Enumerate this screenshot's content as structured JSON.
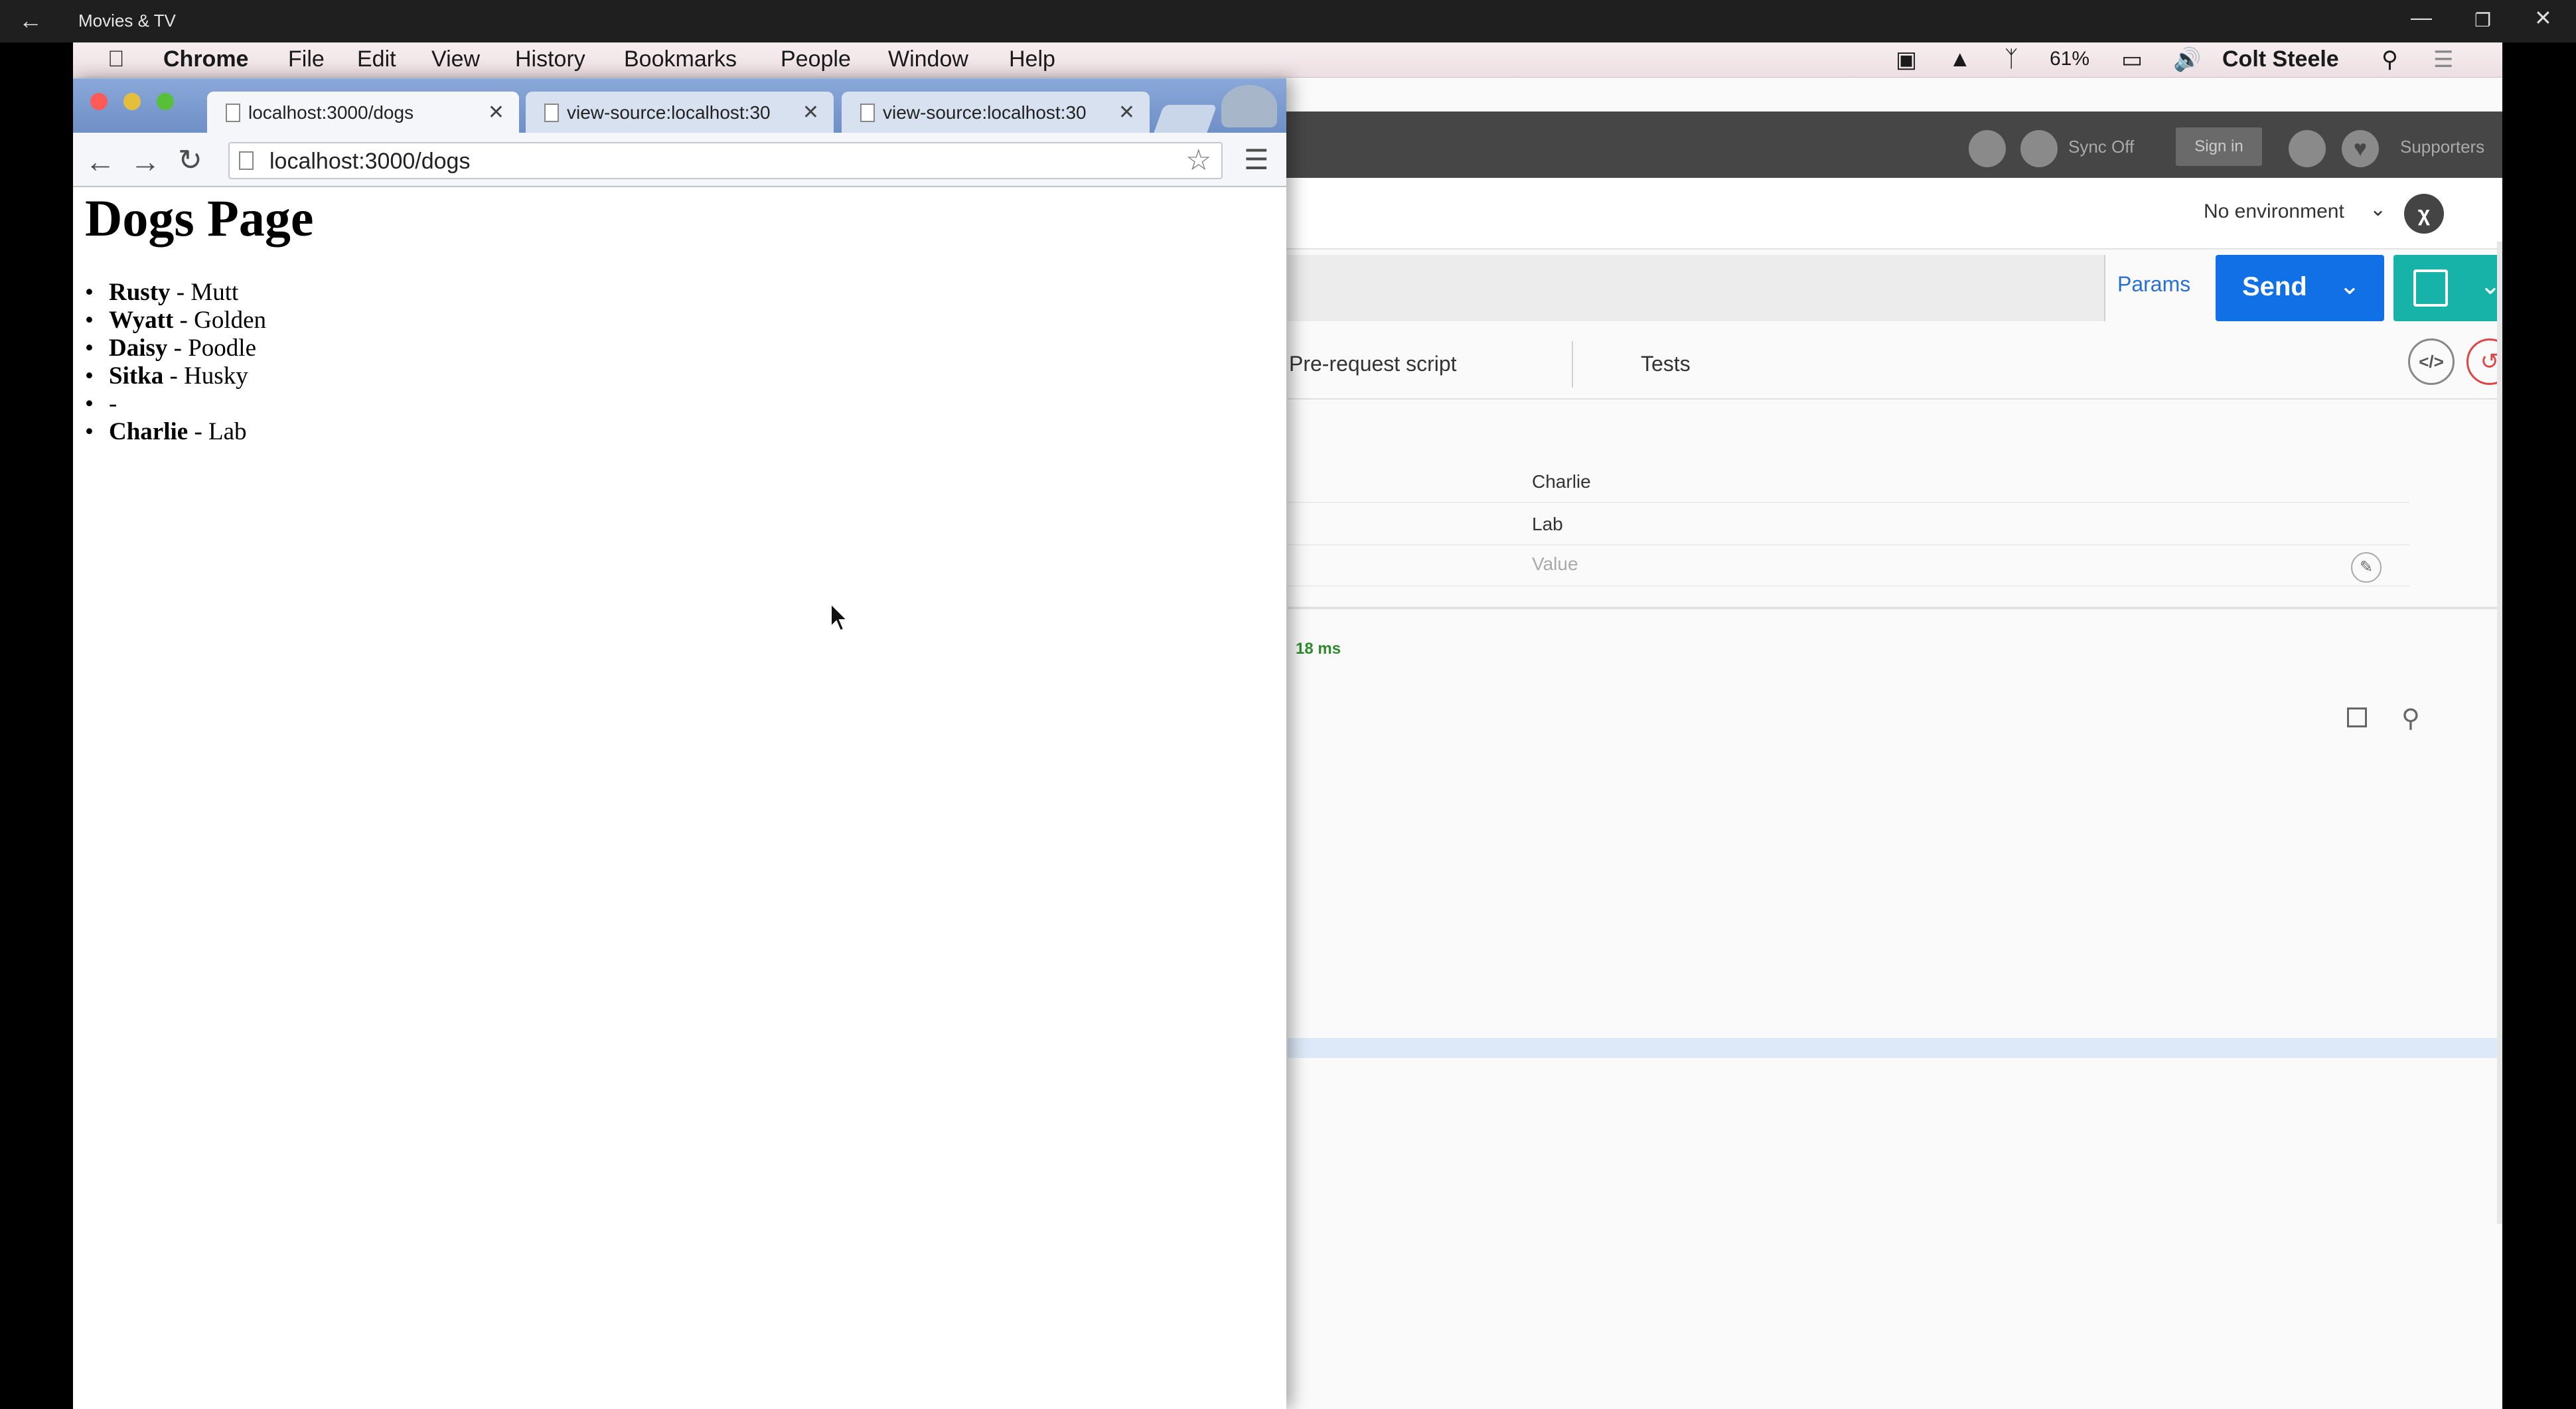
{
  "window": {
    "title": "Movies & TV"
  },
  "menubar": {
    "items": [
      "Chrome",
      "File",
      "Edit",
      "View",
      "History",
      "Bookmarks",
      "People",
      "Window",
      "Help"
    ],
    "battery": "61%",
    "user": "Colt Steele"
  },
  "chrome": {
    "tabs": [
      {
        "label": "localhost:3000/dogs"
      },
      {
        "label": "view-source:localhost:30"
      },
      {
        "label": "view-source:localhost:30"
      }
    ],
    "url": "localhost:3000/dogs"
  },
  "page": {
    "heading": "Dogs Page",
    "dogs": [
      {
        "name": "Rusty",
        "breed": "- Mutt"
      },
      {
        "name": "Wyatt",
        "breed": "- Golden"
      },
      {
        "name": "Daisy",
        "breed": "- Poodle"
      },
      {
        "name": "Sitka",
        "breed": "- Husky"
      },
      {
        "name": "",
        "breed": "-"
      },
      {
        "name": "Charlie",
        "breed": "- Lab"
      }
    ]
  },
  "postman": {
    "sync": "Sync Off",
    "sign_in": "Sign in",
    "supporters": "Supporters",
    "environment": "No environment",
    "params": "Params",
    "send": "Send",
    "tabs": [
      "Pre-request script",
      "Tests"
    ],
    "form_values": [
      "Charlie",
      "Lab"
    ],
    "value_placeholder": "Value",
    "time": "18 ms"
  }
}
